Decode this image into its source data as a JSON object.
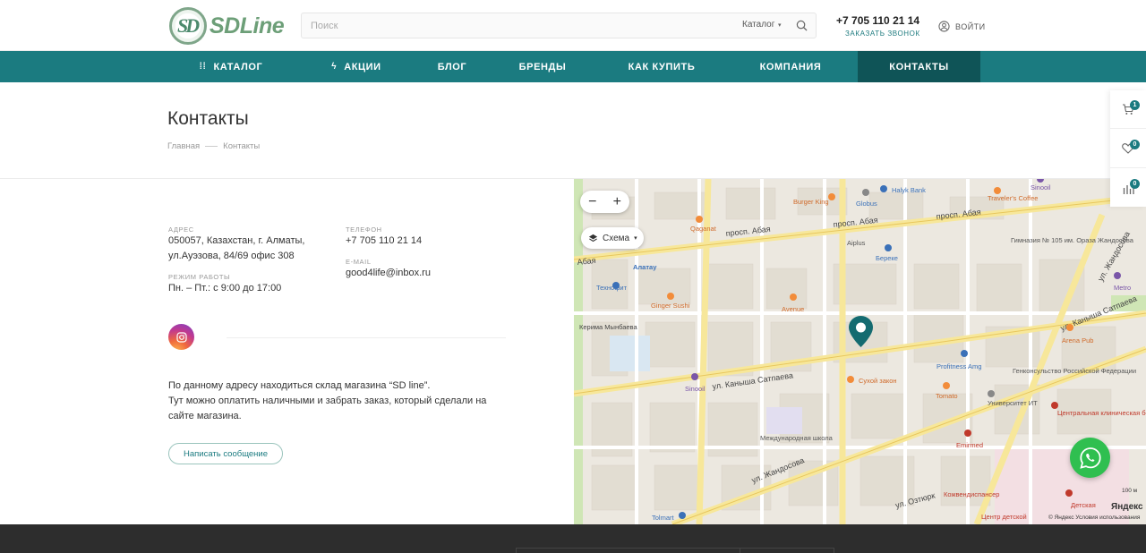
{
  "header": {
    "logo_text": "SDLine",
    "search": {
      "placeholder": "Поиск",
      "category": "Каталог"
    },
    "phone": "+7 705 110 21 14",
    "callback": "ЗАКАЗАТЬ ЗВОНОК",
    "login": "ВОЙТИ"
  },
  "nav": {
    "items": [
      {
        "label": "КАТАЛОГ",
        "icon": "grid-icon"
      },
      {
        "label": "АКЦИИ",
        "icon": "lightning-icon"
      },
      {
        "label": "БЛОГ"
      },
      {
        "label": "БРЕНДЫ"
      },
      {
        "label": "КАК КУПИТЬ"
      },
      {
        "label": "КОМПАНИЯ"
      },
      {
        "label": "КОНТАКТЫ",
        "active": true
      }
    ]
  },
  "page": {
    "title": "Контакты",
    "breadcrumb": [
      "Главная",
      "Контакты"
    ]
  },
  "contacts": {
    "address_label": "АДРЕС",
    "address_line1": "050057, Казахстан, г. Алматы,",
    "address_line2": "ул.Ауэзова, 84/69 офис 308",
    "hours_label": "РЕЖИМ РАБОТЫ",
    "hours": "Пн. – Пт.: с 9:00 до 17:00",
    "phone_label": "ТЕЛЕФОН",
    "phone": "+7 705 110 21 14",
    "email_label": "E-MAIL",
    "email": "good4life@inbox.ru",
    "note_line1": "По данному адресу находиться склад магазина “SD line”.",
    "note_line2": "Тут можно оплатить наличными и забрать заказ, который сделали на",
    "note_line3": "сайте магазина.",
    "message_button": "Написать сообщение"
  },
  "map": {
    "zoom_out": "−",
    "zoom_in": "+",
    "layer": "Схема",
    "labels": {
      "abay1": "просп. Абая",
      "abay2": "просп. Абая",
      "abay3": "просп. Абая",
      "abay4": "Абая",
      "almaly": "Алатау",
      "satpaev": "ул. Каныша Сатпаева",
      "satpaev2": "ул. Каныша Сатпаева",
      "zhandosov": "ул. Жандосова",
      "zhandosov2": "ул. Жандосова",
      "ozturk": "ул. Озтюрк",
      "burger": "Burger King",
      "globus": "Globus",
      "halyk": "Halyk Bank",
      "travelers": "Traveler's Coffee",
      "sinooil": "Sinooil",
      "qaganat": "Qaganat",
      "technodom": "Технофит",
      "ginger": "Ginger Sushi",
      "avenue": "Avenue",
      "aiplus": "Aiplus",
      "bereke": "Береке",
      "gimnaziya": "Гимназия № 105 им. Ораза Жандосова",
      "metro": "Metro",
      "arena": "Arena Pub",
      "profitness": "Profitness Amg",
      "consulate": "Генконсульство Российской Федерации",
      "sukhoy": "Сухой закон",
      "tomato": "Tomato",
      "university": "Университет ИТ",
      "hospital": "Центральная клиническая больница",
      "school": "Международная школа",
      "emirmed": "Emirmed",
      "kozhven": "Кожвендиспансер",
      "detskaya": "Детская",
      "center": "Центр детской",
      "tolmart": "Tolmart",
      "kerima": "Керима Мынбаева",
      "sinooil2": "Sinooil",
      "yandex": "Яндекс",
      "terms": "© Яндекс Условия использования",
      "scale": "100 м"
    }
  },
  "side_panel": {
    "cart_count": "1",
    "favorites_count": "0",
    "compare_count": "0"
  },
  "colors": {
    "accent": "#1b7b80",
    "accent_dark": "#0f5457",
    "footer": "#2d2d2d",
    "whatsapp": "#2fbf50"
  }
}
